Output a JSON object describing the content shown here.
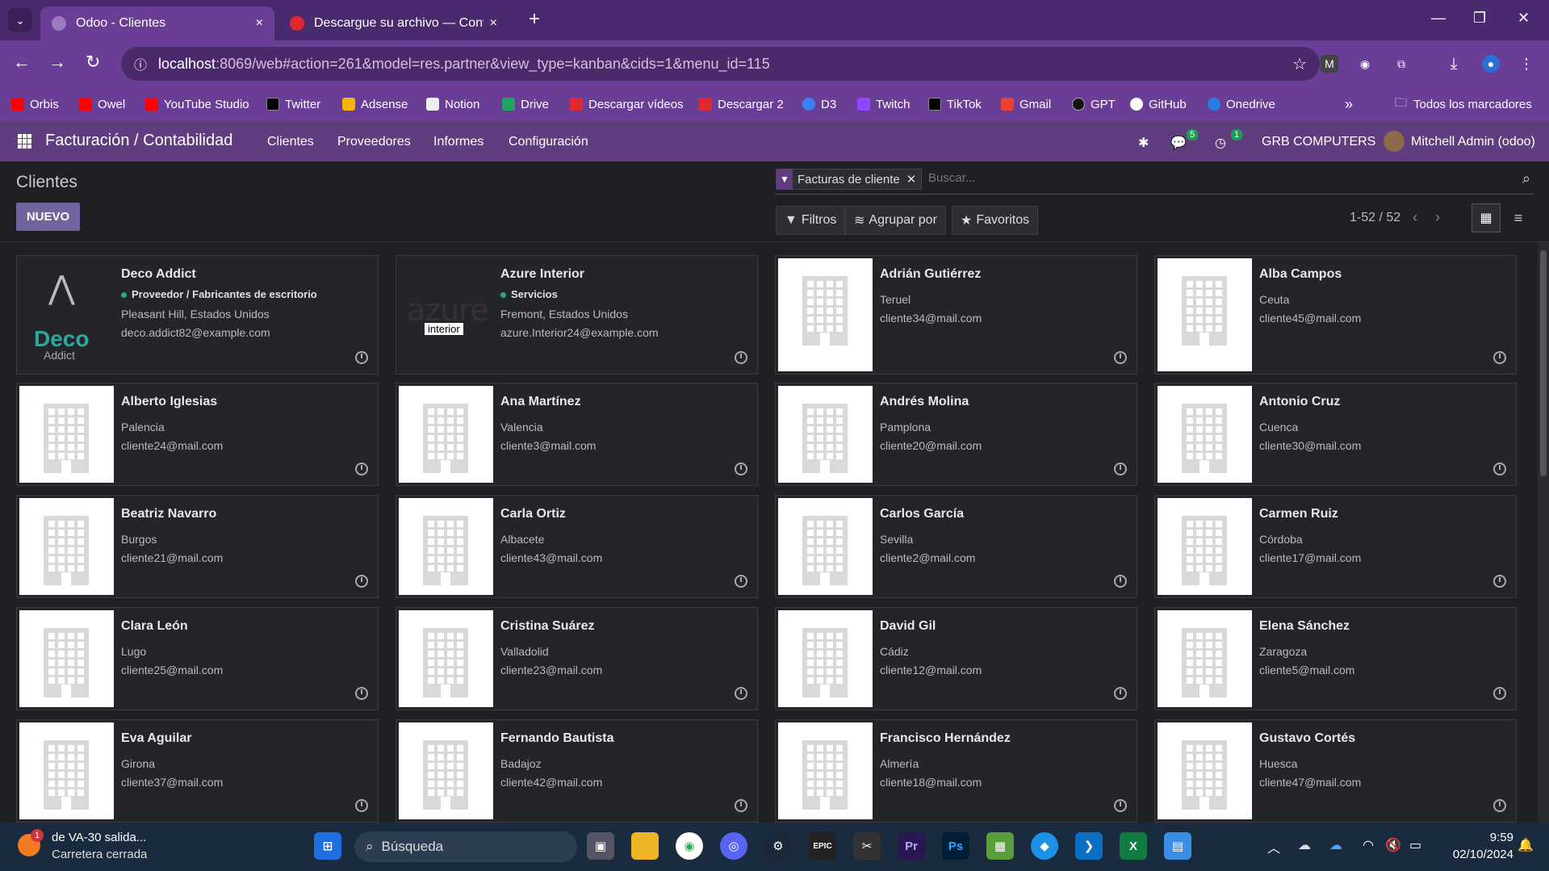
{
  "browser": {
    "tabs": [
      {
        "title": "Odoo - Clientes",
        "active": true
      },
      {
        "title": "Descargue su archivo — Conve",
        "active": false
      }
    ],
    "new_tab_label": "+",
    "close_label": "×",
    "url": {
      "host": "localhost",
      "rest": ":8069/web#action=261&model=res.partner&view_type=kanban&cids=1&menu_id=115"
    },
    "bookmarks": [
      "Orbis",
      "Owel",
      "YouTube Studio",
      "Twitter",
      "Adsense",
      "Notion",
      "Drive",
      "Descargar vídeos",
      "Descargar 2",
      "D3",
      "Twitch",
      "TikTok",
      "Gmail",
      "GPT",
      "GitHub",
      "Onedrive"
    ],
    "bookmarks_more": "»",
    "all_bookmarks": "Todos los marcadores"
  },
  "odoo": {
    "app_title": "Facturación / Contabilidad",
    "menus": [
      "Clientes",
      "Proveedores",
      "Informes",
      "Configuración"
    ],
    "messages_badge": "5",
    "activities_badge": "1",
    "company": "GRB COMPUTERS",
    "user": "Mitchell Admin (odoo)"
  },
  "control": {
    "breadcrumb": "Clientes",
    "new_button": "NUEVO",
    "facet": "Facturas de cliente",
    "search_placeholder": "Buscar...",
    "filters": "Filtros",
    "group_by": "Agrupar por",
    "favorites": "Favoritos",
    "pager": "1-52 / 52"
  },
  "cards": [
    {
      "name": "Deco Addict",
      "tag": "Proveedor / Fabricantes de escritorio",
      "address": "Pleasant Hill, Estados Unidos",
      "email": "deco.addict82@example.com",
      "logo": "deco"
    },
    {
      "name": "Azure Interior",
      "tag": "Servicios",
      "address": "Fremont, Estados Unidos",
      "email": "azure.Interior24@example.com",
      "logo": "azure"
    },
    {
      "name": "Adrián Gutiérrez",
      "city": "Teruel",
      "email": "cliente34@mail.com"
    },
    {
      "name": "Alba Campos",
      "city": "Ceuta",
      "email": "cliente45@mail.com"
    },
    {
      "name": "Alberto Iglesias",
      "city": "Palencia",
      "email": "cliente24@mail.com"
    },
    {
      "name": "Ana Martínez",
      "city": "Valencia",
      "email": "cliente3@mail.com"
    },
    {
      "name": "Andrés Molina",
      "city": "Pamplona",
      "email": "cliente20@mail.com"
    },
    {
      "name": "Antonio Cruz",
      "city": "Cuenca",
      "email": "cliente30@mail.com"
    },
    {
      "name": "Beatriz Navarro",
      "city": "Burgos",
      "email": "cliente21@mail.com"
    },
    {
      "name": "Carla Ortiz",
      "city": "Albacete",
      "email": "cliente43@mail.com"
    },
    {
      "name": "Carlos García",
      "city": "Sevilla",
      "email": "cliente2@mail.com"
    },
    {
      "name": "Carmen Ruiz",
      "city": "Córdoba",
      "email": "cliente17@mail.com"
    },
    {
      "name": "Clara León",
      "city": "Lugo",
      "email": "cliente25@mail.com"
    },
    {
      "name": "Cristina Suárez",
      "city": "Valladolid",
      "email": "cliente23@mail.com"
    },
    {
      "name": "David Gil",
      "city": "Cádiz",
      "email": "cliente12@mail.com"
    },
    {
      "name": "Elena Sánchez",
      "city": "Zaragoza",
      "email": "cliente5@mail.com"
    },
    {
      "name": "Eva Aguilar",
      "city": "Girona",
      "email": "cliente37@mail.com"
    },
    {
      "name": "Fernando Bautista",
      "city": "Badajoz",
      "email": "cliente42@mail.com"
    },
    {
      "name": "Francisco Hernández",
      "city": "Almería",
      "email": "cliente18@mail.com"
    },
    {
      "name": "Gustavo Cortés",
      "city": "Huesca",
      "email": "cliente47@mail.com"
    }
  ],
  "logos": {
    "deco_word": "Deco",
    "deco_sub": "Addict",
    "azure_word": "azure",
    "azure_sub": "interior"
  },
  "taskbar": {
    "weather_badge": "1",
    "weather_title": "de VA-30 salida...",
    "weather_sub": "Carretera cerrada",
    "search": "Búsqueda",
    "time": "9:59",
    "date": "02/10/2024",
    "epic": "EPIC",
    "pr": "Pr",
    "ps": "Ps"
  }
}
